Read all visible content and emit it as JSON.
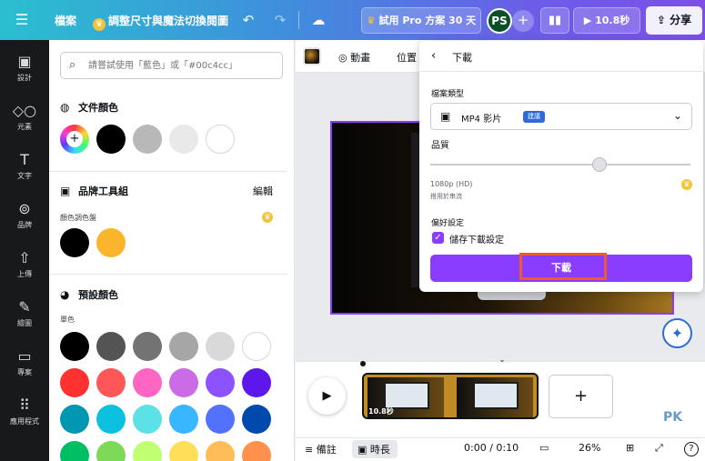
{
  "header": {
    "menu_icon": "hamburger-icon",
    "file_label": "檔案",
    "resize_label": "調整尺寸與魔法切換閱圖",
    "pro_label": "試用 Pro 方案 30 天",
    "avatar_initials": "PS",
    "duration_label": "10.8秒",
    "share_label": "分享",
    "gradient": [
      "#2abfd0",
      "#3f8fdc",
      "#6a5ee8",
      "#7d4fe8"
    ]
  },
  "rail": {
    "items": [
      {
        "label": "設計",
        "icon": "layout-icon"
      },
      {
        "label": "元素",
        "icon": "elements-icon"
      },
      {
        "label": "文字",
        "icon": "text-icon"
      },
      {
        "label": "品牌",
        "icon": "brand-icon"
      },
      {
        "label": "上傳",
        "icon": "upload-icon"
      },
      {
        "label": "繪圖",
        "icon": "draw-icon"
      },
      {
        "label": "專案",
        "icon": "folder-icon"
      },
      {
        "label": "應用程式",
        "icon": "apps-icon"
      }
    ]
  },
  "panel": {
    "search_placeholder": "請嘗試使用「藍色」或「#00c4cc」",
    "doc_colors_title": "文件顏色",
    "doc_colors": [
      "#000000",
      "#b8b8b8",
      "#e9e9e9",
      "#ffffff"
    ],
    "brand_title": "品牌工具組",
    "brand_edit": "編輯",
    "brand_palette_label": "顏色調色盤",
    "brand_colors": [
      "#000000",
      "#fbb52c"
    ],
    "preset_title": "預設顏色",
    "solid_label": "單色",
    "preset_rows": [
      [
        "#000000",
        "#545454",
        "#737373",
        "#a6a6a6",
        "#d9d9d9",
        "#ffffff"
      ],
      [
        "#ff3131",
        "#ff5757",
        "#ff66c4",
        "#cb6ce6",
        "#8c52ff",
        "#5e17eb"
      ],
      [
        "#0097b2",
        "#0cc0df",
        "#5ce1e6",
        "#38b6ff",
        "#5271ff",
        "#004aad"
      ],
      [
        "#00bf63",
        "#7ed957",
        "#c1ff72",
        "#ffde59",
        "#ffbd59",
        "#ff914d"
      ]
    ]
  },
  "toolbar": {
    "animate_label": "動畫",
    "position_label": "位置"
  },
  "download": {
    "title": "下載",
    "file_type_label": "檔案類型",
    "file_type_value": "MP4 影片",
    "file_type_badge": "建議",
    "quality_label": "品質",
    "quality_fraction": 0.65,
    "resolution": "1080p (HD)",
    "resolution_note": "搭用於串流",
    "prefs_label": "偏好設定",
    "save_settings_label": "儲存下載設定",
    "save_settings_checked": true,
    "download_button": "下載",
    "accent": "#8b3dff"
  },
  "timeline": {
    "clip_duration": "10.8秒",
    "add_icon": "plus-icon",
    "watermark": "PK"
  },
  "footer": {
    "notes_label": "備註",
    "timeline_label": "時長",
    "time": "0:00 / 0:10",
    "zoom": "26%",
    "help": "?"
  }
}
